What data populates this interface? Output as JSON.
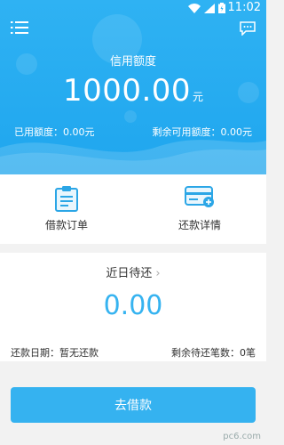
{
  "status_bar": {
    "time": "11:02"
  },
  "credit": {
    "label": "信用额度",
    "amount": "1000.00",
    "unit": "元",
    "used": "已用额度：0.00元",
    "remaining": "剩余可用额度：0.00元"
  },
  "shortcuts": [
    {
      "label": "借款订单",
      "icon": "clipboard-icon"
    },
    {
      "label": "还款详情",
      "icon": "card-icon"
    }
  ],
  "recent": {
    "title": "近日待还",
    "chevron": "›",
    "amount": "0.00",
    "repay_date": "还款日期：暂无还款",
    "pending_count": "剩余待还笔数：0笔"
  },
  "action": {
    "borrow_label": "去借款"
  },
  "watermark": "pc6.com",
  "colors": {
    "primary": "#2fb2f3",
    "amount_text": "#36b3f0",
    "background": "#f2f2f2"
  }
}
